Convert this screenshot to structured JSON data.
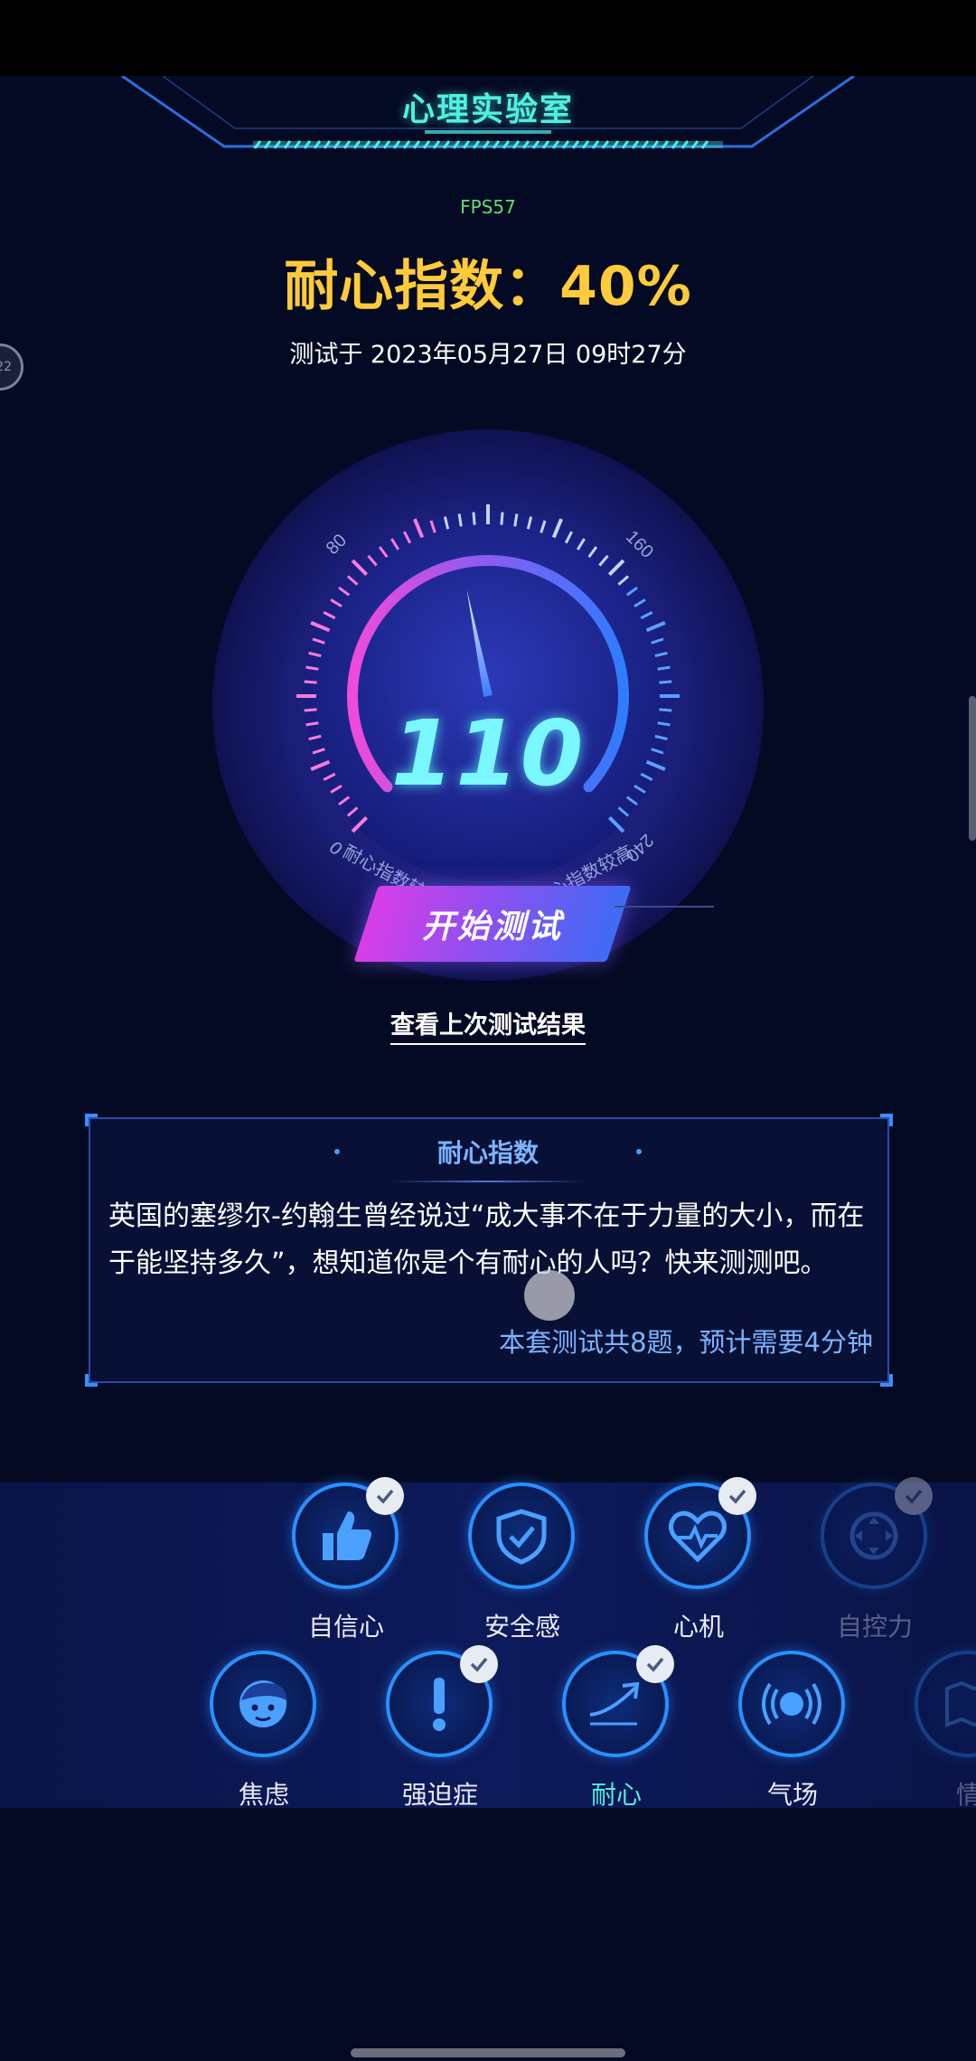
{
  "header": {
    "title": "心理实验室"
  },
  "fps": "FPS57",
  "score": {
    "title": "耐心指数：40%",
    "test_time": "测试于 2023年05月27日 09时27分"
  },
  "side_badge": "22",
  "gauge": {
    "value": "110",
    "tick_labels": [
      "0",
      "80",
      "160",
      "240"
    ],
    "left_caption": "耐心指数较低",
    "right_caption": "耐心指数较高",
    "needle_value": 110,
    "min": 0,
    "max": 240
  },
  "actions": {
    "start_label": "开始测试",
    "last_result_label": "查看上次测试结果"
  },
  "card": {
    "title": "耐心指数",
    "body": "英国的塞缪尔-约翰生曾经说过“成大事不在于力量的大小，而在于能坚持多久”，想知道你是个有耐心的人吗？快来测测吧。",
    "footer": "本套测试共8题，预计需要4分钟"
  },
  "tests": {
    "row1": [
      {
        "label": "自信心",
        "icon": "thumbs-up-icon",
        "checked": true
      },
      {
        "label": "安全感",
        "icon": "shield-check-icon",
        "checked": false
      },
      {
        "label": "心机",
        "icon": "heart-pulse-icon",
        "checked": true
      },
      {
        "label": "自控力",
        "icon": "dpad-icon",
        "checked": true
      }
    ],
    "row2": [
      {
        "label": "焦虑",
        "icon": "face-icon",
        "checked": false
      },
      {
        "label": "强迫症",
        "icon": "exclamation-icon",
        "checked": true
      },
      {
        "label": "耐心",
        "icon": "trend-arrow-icon",
        "checked": true,
        "active": true
      },
      {
        "label": "气场",
        "icon": "broadcast-icon",
        "checked": false
      },
      {
        "label": "情",
        "icon": "map-icon",
        "checked": false
      }
    ]
  },
  "colors": {
    "accent": "#4ff0df",
    "score": "#ffcb3a",
    "primary_blue": "#2a90ff",
    "background": "#050a24"
  }
}
